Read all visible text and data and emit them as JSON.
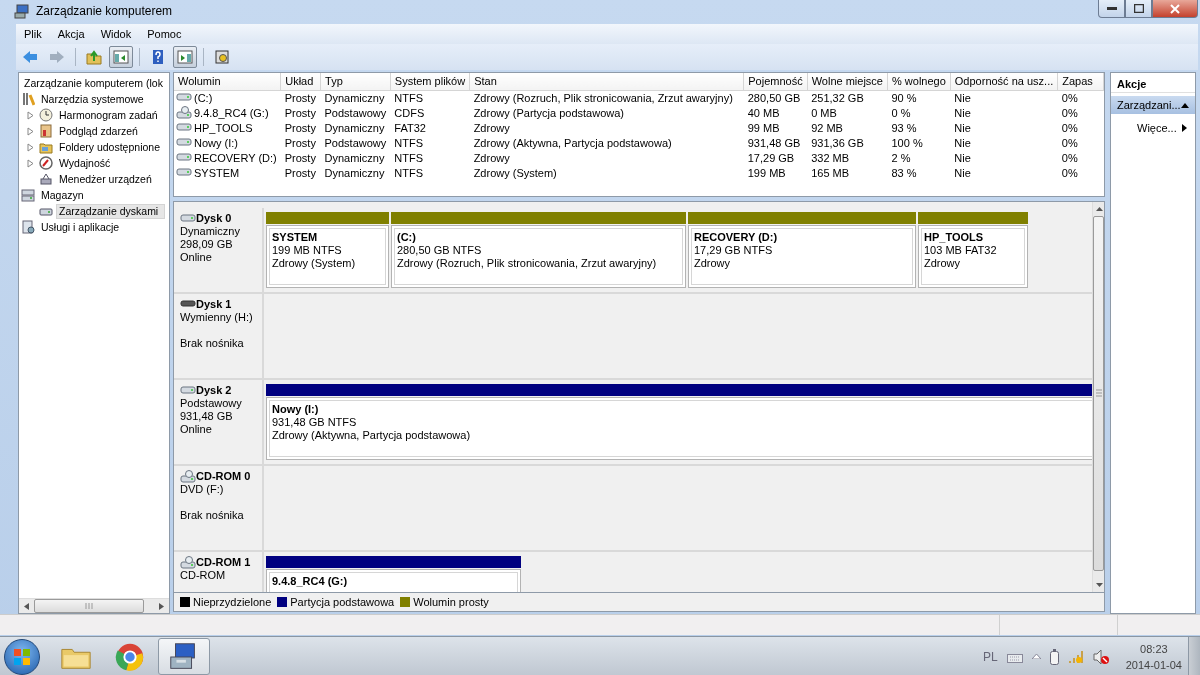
{
  "window": {
    "title": "Zarządzanie komputerem"
  },
  "menu": [
    {
      "label": "Plik"
    },
    {
      "label": "Akcja"
    },
    {
      "label": "Widok"
    },
    {
      "label": "Pomoc"
    }
  ],
  "toolbar": [
    {
      "kind": "back",
      "disabled": false
    },
    {
      "kind": "forward",
      "disabled": true
    },
    {
      "kind": "separator"
    },
    {
      "kind": "up",
      "disabled": false
    },
    {
      "kind": "console-tree",
      "pressed": true
    },
    {
      "kind": "separator"
    },
    {
      "kind": "help",
      "disabled": false
    },
    {
      "kind": "action-pane",
      "pressed": true
    },
    {
      "kind": "separator"
    },
    {
      "kind": "properties",
      "disabled": false
    }
  ],
  "tree": {
    "items": [
      {
        "label": "Zarządzanie komputerem (lok",
        "selected": false,
        "collapsed": false,
        "children": [
          {
            "label": "Narzędzia systemowe",
            "kind": "tools",
            "selected": false,
            "collapsed": false,
            "children": [
              {
                "label": "Harmonogram zadań",
                "kind": "clock",
                "selected": false,
                "collapsed": true
              },
              {
                "label": "Podgląd zdarzeń",
                "kind": "event-log",
                "selected": false,
                "collapsed": true
              },
              {
                "label": "Foldery udostępnione",
                "kind": "shared-folder",
                "selected": false,
                "collapsed": true
              },
              {
                "label": "Wydajność",
                "kind": "performance",
                "selected": false,
                "collapsed": true
              },
              {
                "label": "Menedżer urządzeń",
                "kind": "device",
                "selected": false,
                "collapsed": false
              }
            ]
          },
          {
            "label": "Magazyn",
            "kind": "storage",
            "selected": false,
            "collapsed": false,
            "children": [
              {
                "label": "Zarządzanie dyskami",
                "kind": "disk",
                "selected": true,
                "collapsed": false
              }
            ]
          },
          {
            "label": "Usługi i aplikacje",
            "kind": "services",
            "selected": false,
            "collapsed": false
          }
        ]
      }
    ]
  },
  "table": {
    "columns": [
      "Wolumin",
      "Układ",
      "Typ",
      "System plików",
      "Stan",
      "Pojemność",
      "Wolne miejsce",
      "% wolnego",
      "Odporność na usz...",
      "Zapas"
    ],
    "rows": [
      {
        "kind": "disk",
        "cells": [
          "(C:)",
          "Prosty",
          "Dynamiczny",
          "NTFS",
          "Zdrowy (Rozruch, Plik stronicowania, Zrzut awaryjny)",
          "280,50 GB",
          "251,32 GB",
          "90 %",
          "Nie",
          "0%"
        ]
      },
      {
        "kind": "cd",
        "cells": [
          "9.4.8_RC4 (G:)",
          "Prosty",
          "Podstawowy",
          "CDFS",
          "Zdrowy (Partycja podstawowa)",
          "40 MB",
          "0 MB",
          "0 %",
          "Nie",
          "0%"
        ]
      },
      {
        "kind": "disk",
        "cells": [
          "HP_TOOLS",
          "Prosty",
          "Dynamiczny",
          "FAT32",
          "Zdrowy",
          "99 MB",
          "92 MB",
          "93 %",
          "Nie",
          "0%"
        ]
      },
      {
        "kind": "disk",
        "cells": [
          "Nowy (I:)",
          "Prosty",
          "Podstawowy",
          "NTFS",
          "Zdrowy (Aktywna, Partycja podstawowa)",
          "931,48 GB",
          "931,36 GB",
          "100 %",
          "Nie",
          "0%"
        ]
      },
      {
        "kind": "disk",
        "cells": [
          "RECOVERY (D:)",
          "Prosty",
          "Dynamiczny",
          "NTFS",
          "Zdrowy",
          "17,29 GB",
          "332 MB",
          "2 %",
          "Nie",
          "0%"
        ]
      },
      {
        "kind": "disk",
        "cells": [
          "SYSTEM",
          "Prosty",
          "Dynamiczny",
          "NTFS",
          "Zdrowy (System)",
          "199 MB",
          "165 MB",
          "83 %",
          "Nie",
          "0%"
        ]
      }
    ]
  },
  "disks": [
    {
      "name": "Dysk 0",
      "kind": "disk",
      "type": "Dynamiczny",
      "size": "298,09 GB",
      "status": "Online",
      "partitions": [
        {
          "title": "SYSTEM",
          "kind": "simple",
          "size": "199 MB NTFS",
          "status": "Zdrowy (System)"
        },
        {
          "title": "(C:)",
          "kind": "simple",
          "size": "280,50 GB NTFS",
          "status": "Zdrowy (Rozruch, Plik stronicowania, Zrzut awaryjny)"
        },
        {
          "title": "RECOVERY (D:)",
          "kind": "simple",
          "size": "17,29 GB NTFS",
          "status": "Zdrowy"
        },
        {
          "title": "HP_TOOLS",
          "kind": "simple",
          "size": "103 MB FAT32",
          "status": "Zdrowy"
        }
      ]
    },
    {
      "name": "Dysk 1",
      "kind": "removable",
      "type": "Wymienny (H:)",
      "status": "Brak nośnika"
    },
    {
      "name": "Dysk 2",
      "kind": "disk",
      "type": "Podstawowy",
      "size": "931,48 GB",
      "status": "Online",
      "partitions": [
        {
          "title": "Nowy (I:)",
          "kind": "primary",
          "size": "931,48 GB NTFS",
          "status": "Zdrowy (Aktywna, Partycja podstawowa)"
        }
      ]
    },
    {
      "name": "CD-ROM 0",
      "kind": "cd",
      "type": "DVD (F:)",
      "status": "Brak nośnika"
    },
    {
      "name": "CD-ROM 1",
      "kind": "cd",
      "type": "CD-ROM",
      "partitions": [
        {
          "title": "9.4.8_RC4 (G:)",
          "kind": "primary"
        }
      ]
    }
  ],
  "legend": [
    {
      "label": "Nieprzydzielone",
      "color": "#000000"
    },
    {
      "label": "Partycja podstawowa",
      "color": "#000080"
    },
    {
      "label": "Wolumin prosty",
      "color": "#808000"
    }
  ],
  "actions": {
    "title": "Akcje",
    "items": [
      {
        "label": "Zarządzani...",
        "kind": "group"
      },
      {
        "label": "Więce...",
        "kind": "link"
      }
    ]
  },
  "taskbar": {
    "apps": [
      {
        "kind": "folder",
        "active": false
      },
      {
        "kind": "browser",
        "active": false
      },
      {
        "kind": "management",
        "active": true
      }
    ],
    "tray": {
      "language": "PL",
      "time": "08:23",
      "date": "2014-01-04"
    }
  }
}
